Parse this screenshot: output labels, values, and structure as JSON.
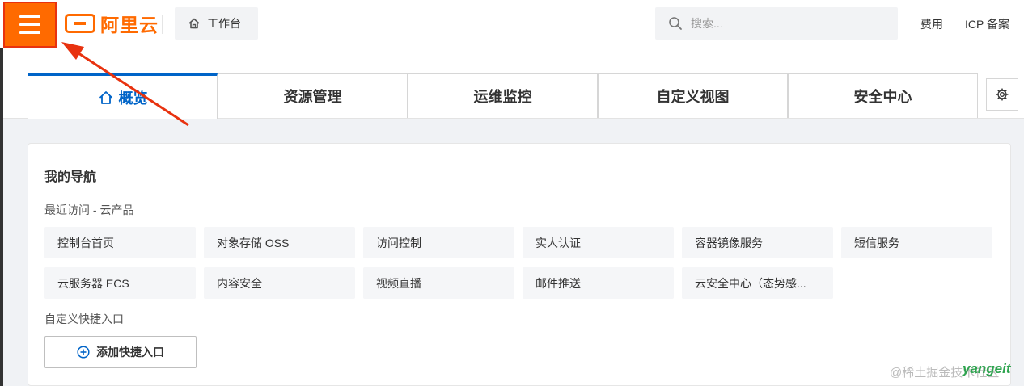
{
  "header": {
    "logo_text": "阿里云",
    "workbench_label": "工作台",
    "search_placeholder": "搜索...",
    "links": [
      "费用",
      "ICP 备案"
    ]
  },
  "tabs": [
    {
      "label": "概览",
      "active": true
    },
    {
      "label": "资源管理",
      "active": false
    },
    {
      "label": "运维监控",
      "active": false
    },
    {
      "label": "自定义视图",
      "active": false
    },
    {
      "label": "安全中心",
      "active": false
    }
  ],
  "nav": {
    "title": "我的导航",
    "recent_label": "最近访问 - 云产品",
    "products": [
      "控制台首页",
      "对象存储 OSS",
      "访问控制",
      "实人认证",
      "容器镜像服务",
      "短信服务",
      "云服务器 ECS",
      "内容安全",
      "视频直播",
      "邮件推送",
      "云安全中心（态势感..."
    ],
    "custom_label": "自定义快捷入口",
    "add_button_label": "添加快捷入口"
  },
  "watermark": {
    "text": "@稀土掘金技术社区",
    "brand": "yangeit"
  },
  "colors": {
    "brand": "#ff6a00",
    "accent": "#0064c8",
    "annotation": "#e8320f"
  }
}
